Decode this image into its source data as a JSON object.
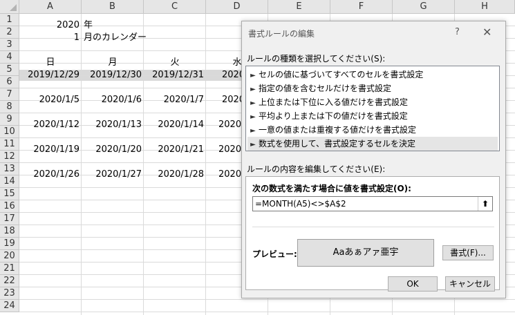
{
  "columns": [
    "A",
    "B",
    "C",
    "D",
    "E",
    "F",
    "G",
    "H"
  ],
  "rows": [
    "1",
    "2",
    "3",
    "4",
    "5",
    "6",
    "7",
    "8",
    "9",
    "10",
    "11",
    "12",
    "13",
    "14",
    "15",
    "16",
    "17",
    "18",
    "19",
    "20",
    "21",
    "22",
    "23",
    "24"
  ],
  "cells": {
    "A1": "2020",
    "B1": "年",
    "A2": "1",
    "B2": "月のカレンダー",
    "A4": "日",
    "B4": "月",
    "C4": "火",
    "D4": "水",
    "A5": "2019/12/29",
    "B5": "2019/12/30",
    "C5": "2019/12/31",
    "D5": "2020/",
    "A7": "2020/1/5",
    "B7": "2020/1/6",
    "C7": "2020/1/7",
    "D7": "2020/",
    "A9": "2020/1/12",
    "B9": "2020/1/13",
    "C9": "2020/1/14",
    "D9": "2020/",
    "A11": "2020/1/19",
    "B11": "2020/1/20",
    "C11": "2020/1/21",
    "D11": "2020/",
    "A13": "2020/1/26",
    "B13": "2020/1/27",
    "C13": "2020/1/28",
    "D13": "2020/"
  },
  "dialog": {
    "title": "書式ルールの編集",
    "help": "?",
    "close": "✕",
    "rule_type_label": "ルールの種類を選択してください(S):",
    "rule_types": [
      "セルの値に基づいてすべてのセルを書式設定",
      "指定の値を含むセルだけを書式設定",
      "上位または下位に入る値だけを書式設定",
      "平均より上または下の値だけを書式設定",
      "一意の値または重複する値だけを書式設定",
      "数式を使用して、書式設定するセルを決定"
    ],
    "selected_rule_index": 5,
    "edit_label": "ルールの内容を編集してください(E):",
    "formula_label": "次の数式を満たす場合に値を書式設定(O):",
    "formula": "=MONTH(A5)<>$A$2",
    "collapse_icon": "⬆",
    "preview_label": "プレビュー:",
    "preview_text": "Aaあぁアァ亜宇",
    "format_button": "書式(F)...",
    "ok": "OK",
    "cancel": "キャンセル"
  }
}
